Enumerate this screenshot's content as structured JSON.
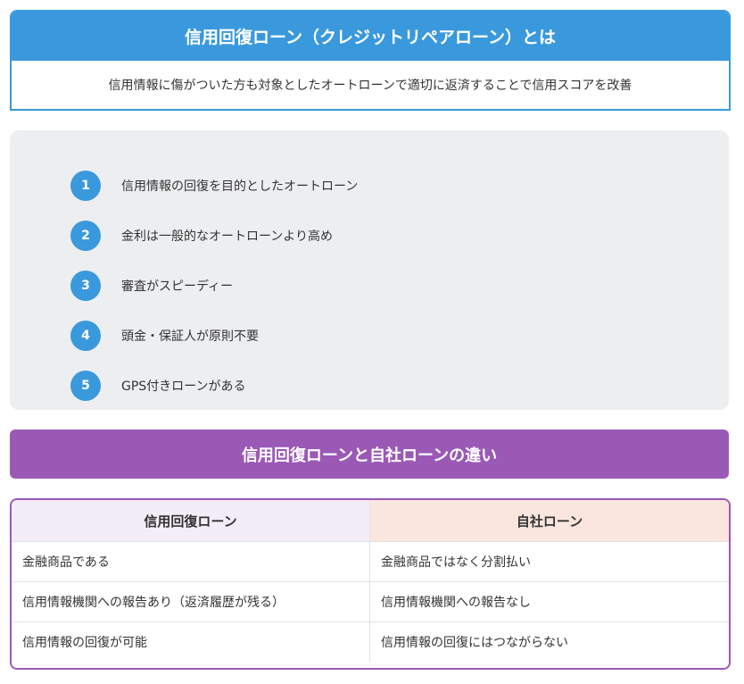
{
  "definition": {
    "title": "信用回復ローン（クレジットリペアローン）とは",
    "description": "信用情報に傷がついた方も対象としたオートローンで適切に返済することで信用スコアを改善"
  },
  "features": {
    "items": [
      {
        "number": "1",
        "text": "信用情報の回復を目的としたオートローン"
      },
      {
        "number": "2",
        "text": "金利は一般的なオートローンより高め"
      },
      {
        "number": "3",
        "text": "審査がスピーディー"
      },
      {
        "number": "4",
        "text": "頭金・保証人が原則不要"
      },
      {
        "number": "5",
        "text": "GPS付きローンがある"
      }
    ]
  },
  "comparison": {
    "title": "信用回復ローンと自社ローンの違い",
    "columns": [
      "信用回復ローン",
      "自社ローン"
    ],
    "rows": [
      [
        "金融商品である",
        "金融商品ではなく分割払い"
      ],
      [
        "信用情報機関への報告あり（返済履歴が残る）",
        "信用情報機関への報告なし"
      ],
      [
        "信用情報の回復が可能",
        "信用情報の回復にはつながらない"
      ]
    ]
  },
  "colors": {
    "blue_accent": "#3a99dc",
    "purple_accent": "#9b59b6",
    "gray_panel": "#eceef0",
    "left_header_bg": "#f3ecf9",
    "right_header_bg": "#fae6de"
  }
}
